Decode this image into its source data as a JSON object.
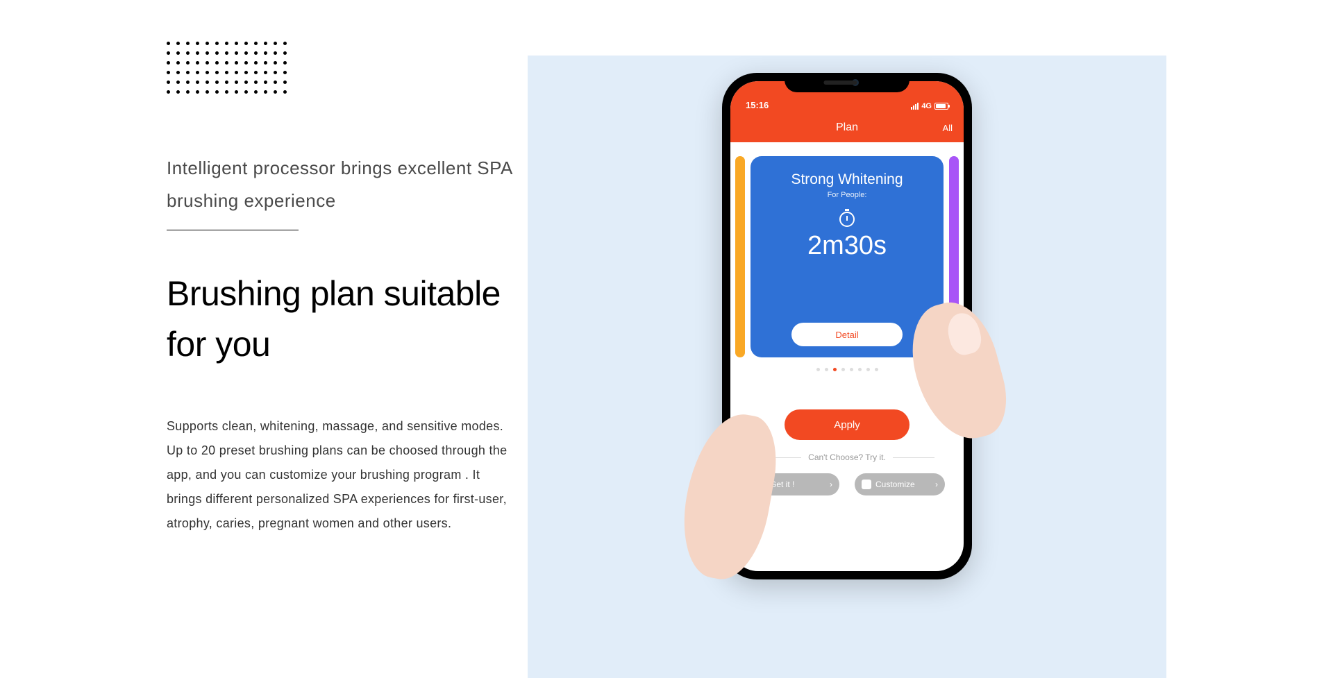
{
  "left": {
    "subtitle": "Intelligent processor brings excellent SPA brushing experience",
    "title": "Brushing plan suitable for you",
    "body": "Supports clean, whitening, massage, and sensitive modes. Up to 20 preset brushing plans can be choosed through the app, and you can customize your brushing program . It brings different personalized SPA experiences for first-user, atrophy, caries, pregnant women and other users."
  },
  "phone": {
    "status": {
      "time": "15:16",
      "network": "4G"
    },
    "header": {
      "title": "Plan",
      "all": "All"
    },
    "card": {
      "title": "Strong Whitening",
      "subtitle": "For People:",
      "duration": "2m30s",
      "detail": "Detail"
    },
    "apply": "Apply",
    "hint": "Can't Choose? Try it.",
    "pills": {
      "getit": "Get it !",
      "customize": "Customize"
    }
  }
}
